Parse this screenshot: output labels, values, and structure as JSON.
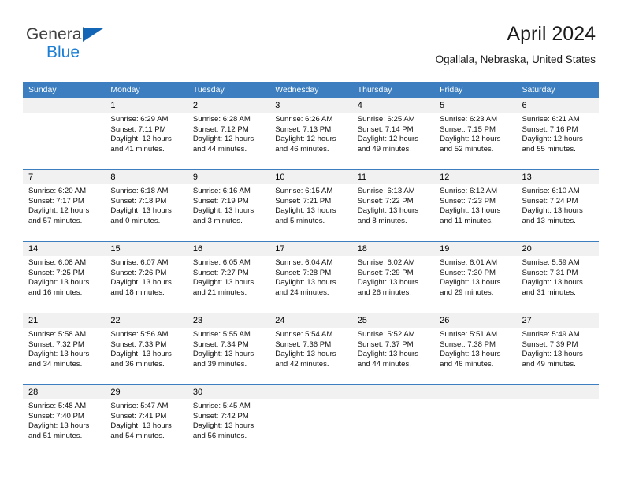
{
  "brand": {
    "line1": "General",
    "line2": "Blue",
    "mark": "blue-triangle"
  },
  "header": {
    "title": "April 2024",
    "location": "Ogallala, Nebraska, United States"
  },
  "colors": {
    "header_blue": "#3c7ebf",
    "brand_blue": "#1c7fd4",
    "daynum_band": "#f1f1f1"
  },
  "weekdays": [
    "Sunday",
    "Monday",
    "Tuesday",
    "Wednesday",
    "Thursday",
    "Friday",
    "Saturday"
  ],
  "weeks": [
    [
      {
        "day": "",
        "empty": true
      },
      {
        "day": "1",
        "sunrise": "Sunrise: 6:29 AM",
        "sunset": "Sunset: 7:11 PM",
        "daylight1": "Daylight: 12 hours",
        "daylight2": "and 41 minutes."
      },
      {
        "day": "2",
        "sunrise": "Sunrise: 6:28 AM",
        "sunset": "Sunset: 7:12 PM",
        "daylight1": "Daylight: 12 hours",
        "daylight2": "and 44 minutes."
      },
      {
        "day": "3",
        "sunrise": "Sunrise: 6:26 AM",
        "sunset": "Sunset: 7:13 PM",
        "daylight1": "Daylight: 12 hours",
        "daylight2": "and 46 minutes."
      },
      {
        "day": "4",
        "sunrise": "Sunrise: 6:25 AM",
        "sunset": "Sunset: 7:14 PM",
        "daylight1": "Daylight: 12 hours",
        "daylight2": "and 49 minutes."
      },
      {
        "day": "5",
        "sunrise": "Sunrise: 6:23 AM",
        "sunset": "Sunset: 7:15 PM",
        "daylight1": "Daylight: 12 hours",
        "daylight2": "and 52 minutes."
      },
      {
        "day": "6",
        "sunrise": "Sunrise: 6:21 AM",
        "sunset": "Sunset: 7:16 PM",
        "daylight1": "Daylight: 12 hours",
        "daylight2": "and 55 minutes."
      }
    ],
    [
      {
        "day": "7",
        "sunrise": "Sunrise: 6:20 AM",
        "sunset": "Sunset: 7:17 PM",
        "daylight1": "Daylight: 12 hours",
        "daylight2": "and 57 minutes."
      },
      {
        "day": "8",
        "sunrise": "Sunrise: 6:18 AM",
        "sunset": "Sunset: 7:18 PM",
        "daylight1": "Daylight: 13 hours",
        "daylight2": "and 0 minutes."
      },
      {
        "day": "9",
        "sunrise": "Sunrise: 6:16 AM",
        "sunset": "Sunset: 7:19 PM",
        "daylight1": "Daylight: 13 hours",
        "daylight2": "and 3 minutes."
      },
      {
        "day": "10",
        "sunrise": "Sunrise: 6:15 AM",
        "sunset": "Sunset: 7:21 PM",
        "daylight1": "Daylight: 13 hours",
        "daylight2": "and 5 minutes."
      },
      {
        "day": "11",
        "sunrise": "Sunrise: 6:13 AM",
        "sunset": "Sunset: 7:22 PM",
        "daylight1": "Daylight: 13 hours",
        "daylight2": "and 8 minutes."
      },
      {
        "day": "12",
        "sunrise": "Sunrise: 6:12 AM",
        "sunset": "Sunset: 7:23 PM",
        "daylight1": "Daylight: 13 hours",
        "daylight2": "and 11 minutes."
      },
      {
        "day": "13",
        "sunrise": "Sunrise: 6:10 AM",
        "sunset": "Sunset: 7:24 PM",
        "daylight1": "Daylight: 13 hours",
        "daylight2": "and 13 minutes."
      }
    ],
    [
      {
        "day": "14",
        "sunrise": "Sunrise: 6:08 AM",
        "sunset": "Sunset: 7:25 PM",
        "daylight1": "Daylight: 13 hours",
        "daylight2": "and 16 minutes."
      },
      {
        "day": "15",
        "sunrise": "Sunrise: 6:07 AM",
        "sunset": "Sunset: 7:26 PM",
        "daylight1": "Daylight: 13 hours",
        "daylight2": "and 18 minutes."
      },
      {
        "day": "16",
        "sunrise": "Sunrise: 6:05 AM",
        "sunset": "Sunset: 7:27 PM",
        "daylight1": "Daylight: 13 hours",
        "daylight2": "and 21 minutes."
      },
      {
        "day": "17",
        "sunrise": "Sunrise: 6:04 AM",
        "sunset": "Sunset: 7:28 PM",
        "daylight1": "Daylight: 13 hours",
        "daylight2": "and 24 minutes."
      },
      {
        "day": "18",
        "sunrise": "Sunrise: 6:02 AM",
        "sunset": "Sunset: 7:29 PM",
        "daylight1": "Daylight: 13 hours",
        "daylight2": "and 26 minutes."
      },
      {
        "day": "19",
        "sunrise": "Sunrise: 6:01 AM",
        "sunset": "Sunset: 7:30 PM",
        "daylight1": "Daylight: 13 hours",
        "daylight2": "and 29 minutes."
      },
      {
        "day": "20",
        "sunrise": "Sunrise: 5:59 AM",
        "sunset": "Sunset: 7:31 PM",
        "daylight1": "Daylight: 13 hours",
        "daylight2": "and 31 minutes."
      }
    ],
    [
      {
        "day": "21",
        "sunrise": "Sunrise: 5:58 AM",
        "sunset": "Sunset: 7:32 PM",
        "daylight1": "Daylight: 13 hours",
        "daylight2": "and 34 minutes."
      },
      {
        "day": "22",
        "sunrise": "Sunrise: 5:56 AM",
        "sunset": "Sunset: 7:33 PM",
        "daylight1": "Daylight: 13 hours",
        "daylight2": "and 36 minutes."
      },
      {
        "day": "23",
        "sunrise": "Sunrise: 5:55 AM",
        "sunset": "Sunset: 7:34 PM",
        "daylight1": "Daylight: 13 hours",
        "daylight2": "and 39 minutes."
      },
      {
        "day": "24",
        "sunrise": "Sunrise: 5:54 AM",
        "sunset": "Sunset: 7:36 PM",
        "daylight1": "Daylight: 13 hours",
        "daylight2": "and 42 minutes."
      },
      {
        "day": "25",
        "sunrise": "Sunrise: 5:52 AM",
        "sunset": "Sunset: 7:37 PM",
        "daylight1": "Daylight: 13 hours",
        "daylight2": "and 44 minutes."
      },
      {
        "day": "26",
        "sunrise": "Sunrise: 5:51 AM",
        "sunset": "Sunset: 7:38 PM",
        "daylight1": "Daylight: 13 hours",
        "daylight2": "and 46 minutes."
      },
      {
        "day": "27",
        "sunrise": "Sunrise: 5:49 AM",
        "sunset": "Sunset: 7:39 PM",
        "daylight1": "Daylight: 13 hours",
        "daylight2": "and 49 minutes."
      }
    ],
    [
      {
        "day": "28",
        "sunrise": "Sunrise: 5:48 AM",
        "sunset": "Sunset: 7:40 PM",
        "daylight1": "Daylight: 13 hours",
        "daylight2": "and 51 minutes."
      },
      {
        "day": "29",
        "sunrise": "Sunrise: 5:47 AM",
        "sunset": "Sunset: 7:41 PM",
        "daylight1": "Daylight: 13 hours",
        "daylight2": "and 54 minutes."
      },
      {
        "day": "30",
        "sunrise": "Sunrise: 5:45 AM",
        "sunset": "Sunset: 7:42 PM",
        "daylight1": "Daylight: 13 hours",
        "daylight2": "and 56 minutes."
      },
      {
        "day": "",
        "empty": true
      },
      {
        "day": "",
        "empty": true
      },
      {
        "day": "",
        "empty": true
      },
      {
        "day": "",
        "empty": true
      }
    ]
  ]
}
